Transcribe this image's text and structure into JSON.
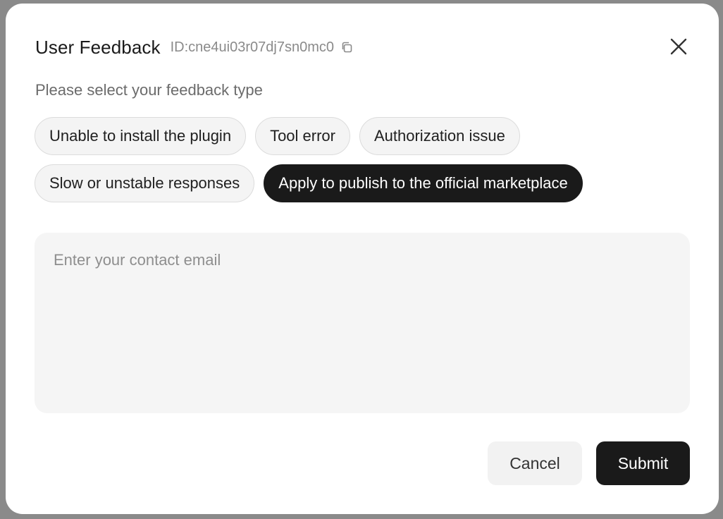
{
  "modal": {
    "title": "User Feedback",
    "id_text": "ID:cne4ui03r07dj7sn0mc0",
    "copy_icon": "copy-icon",
    "close_icon": "close-icon",
    "prompt": "Please select your feedback type",
    "feedback_types": [
      {
        "label": "Unable to install the plugin",
        "selected": false
      },
      {
        "label": "Tool error",
        "selected": false
      },
      {
        "label": "Authorization issue",
        "selected": false
      },
      {
        "label": "Slow or unstable responses",
        "selected": false
      },
      {
        "label": "Apply to publish to the official marketplace",
        "selected": true
      }
    ],
    "email": {
      "value": "",
      "placeholder": "Enter your contact email"
    },
    "cancel_label": "Cancel",
    "submit_label": "Submit"
  },
  "colors": {
    "selected_chip": "#1a1a1a",
    "submit_bg": "#1a1a1a",
    "backdrop": "#8a8a8a"
  }
}
